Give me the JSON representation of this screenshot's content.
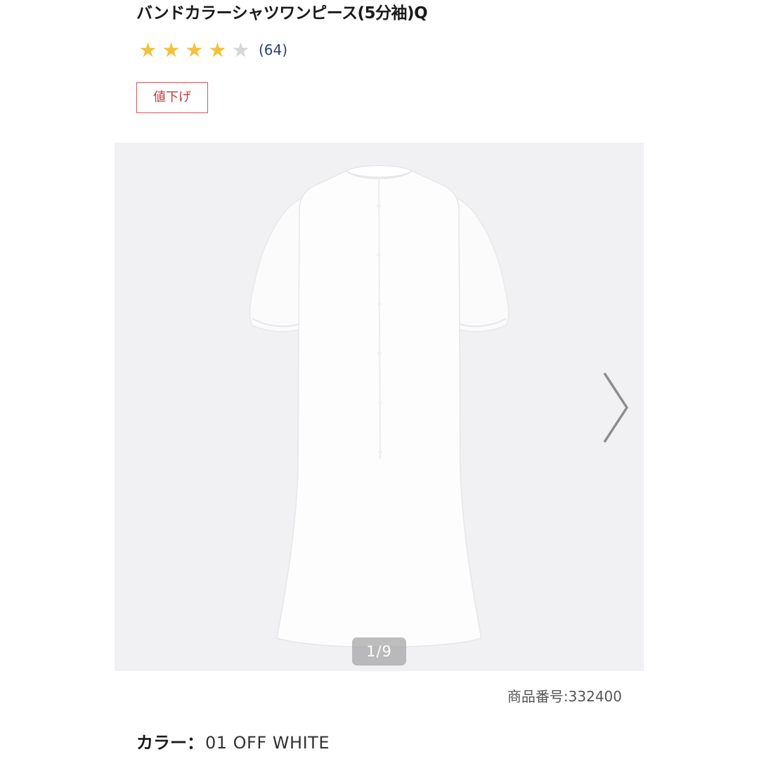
{
  "product": {
    "title": "バンドカラーシャツワンピース(5分袖)Q",
    "rating": {
      "value": 4,
      "max": 5,
      "review_count": "(64)",
      "star_color": "#f3c142",
      "empty_star_color": "#d7d7d7"
    },
    "badge": "値下げ",
    "badge_color": "#c53b3b",
    "gallery": {
      "counter": "1/9",
      "next_icon": "chevron-right-icon",
      "background": "#f1f0f3"
    },
    "sku": "商品番号:332400",
    "color": {
      "label": "カラー：",
      "value": "01 OFF WHITE"
    }
  }
}
